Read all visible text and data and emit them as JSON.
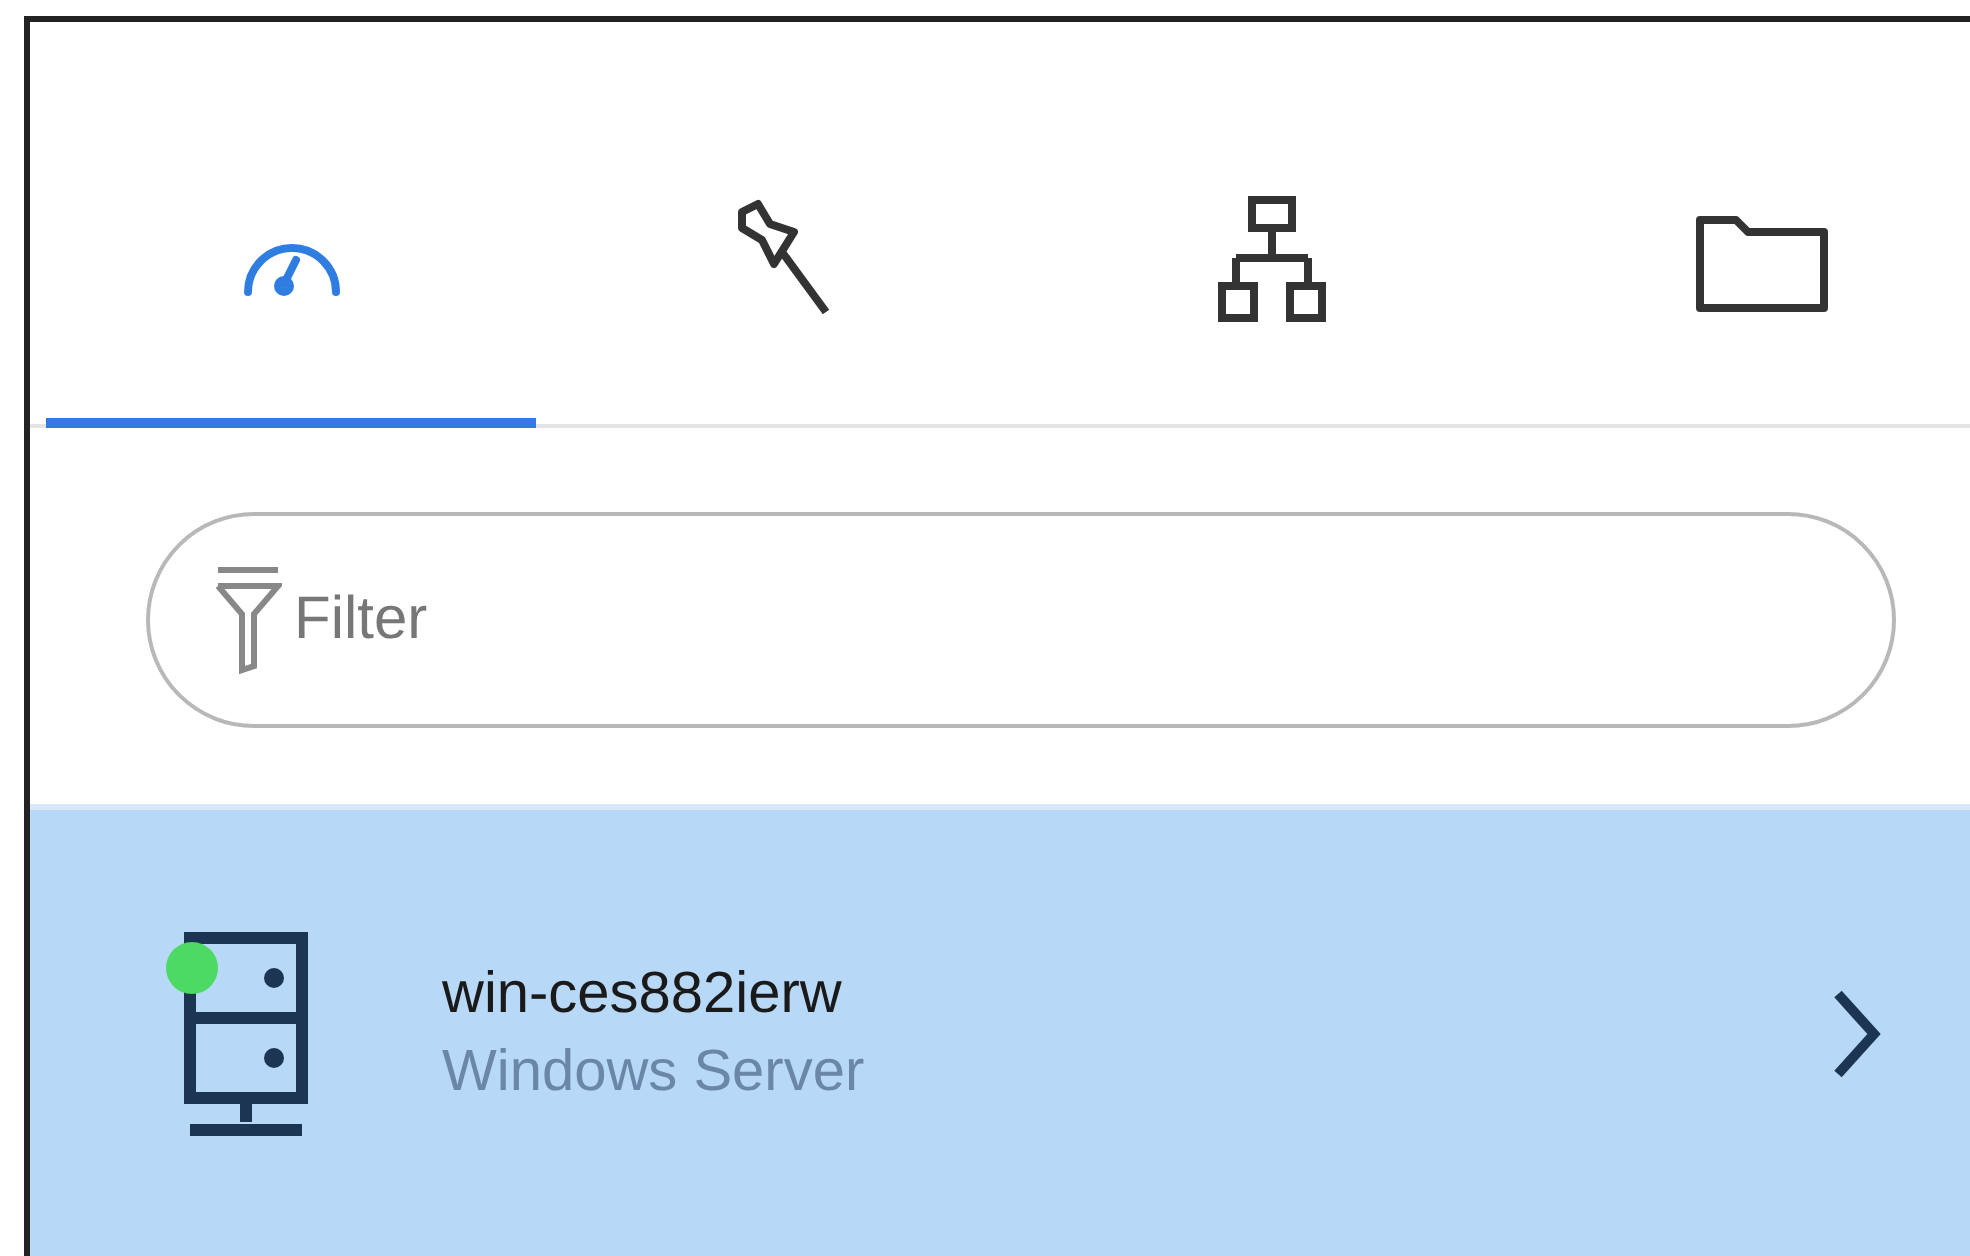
{
  "tabs": [
    {
      "kind": "gauge",
      "selected": true
    },
    {
      "kind": "pin",
      "selected": false
    },
    {
      "kind": "hierarchy",
      "selected": false
    },
    {
      "kind": "folder",
      "selected": false
    }
  ],
  "filter": {
    "placeholder": "Filter"
  },
  "items": [
    {
      "kind": "server",
      "name": "win-ces882ierw",
      "subtitle": "Windows Server",
      "color": "#4cd964",
      "selected": true
    }
  ]
}
